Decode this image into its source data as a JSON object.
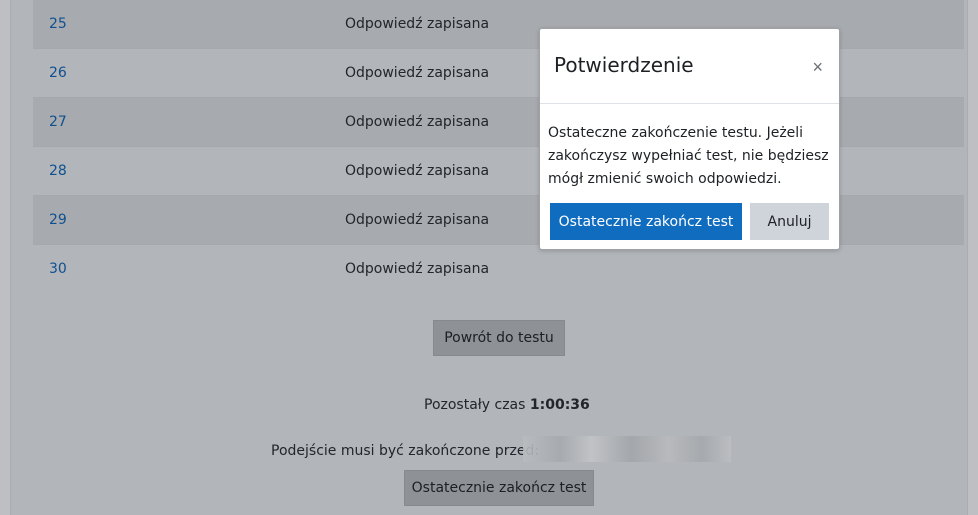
{
  "summary": {
    "rows": [
      {
        "number": "25",
        "status": "Odpowiedź zapisana"
      },
      {
        "number": "26",
        "status": "Odpowiedź zapisana"
      },
      {
        "number": "27",
        "status": "Odpowiedź zapisana"
      },
      {
        "number": "28",
        "status": "Odpowiedź zapisana"
      },
      {
        "number": "29",
        "status": "Odpowiedź zapisana"
      },
      {
        "number": "30",
        "status": "Odpowiedź zapisana"
      }
    ]
  },
  "actions": {
    "back_label": "Powrót do testu",
    "finish_label": "Ostatecznie zakończ test"
  },
  "timer": {
    "label": "Pozostały czas",
    "value": "1:00:36"
  },
  "deadline": {
    "label": "Podejście musi być zakończone przed:"
  },
  "modal": {
    "title": "Potwierdzenie",
    "close_glyph": "×",
    "body": "Ostateczne zakończenie testu. Jeżeli zakończysz wypełniać test, nie będziesz mógł zmienić swoich odpowiedzi.",
    "confirm_label": "Ostatecznie zakończ test",
    "cancel_label": "Anuluj"
  },
  "colors": {
    "link": "#10508f",
    "primary": "#0f6cbf",
    "secondary": "#ced4da",
    "overlay_dim": "#b2b5b9"
  }
}
